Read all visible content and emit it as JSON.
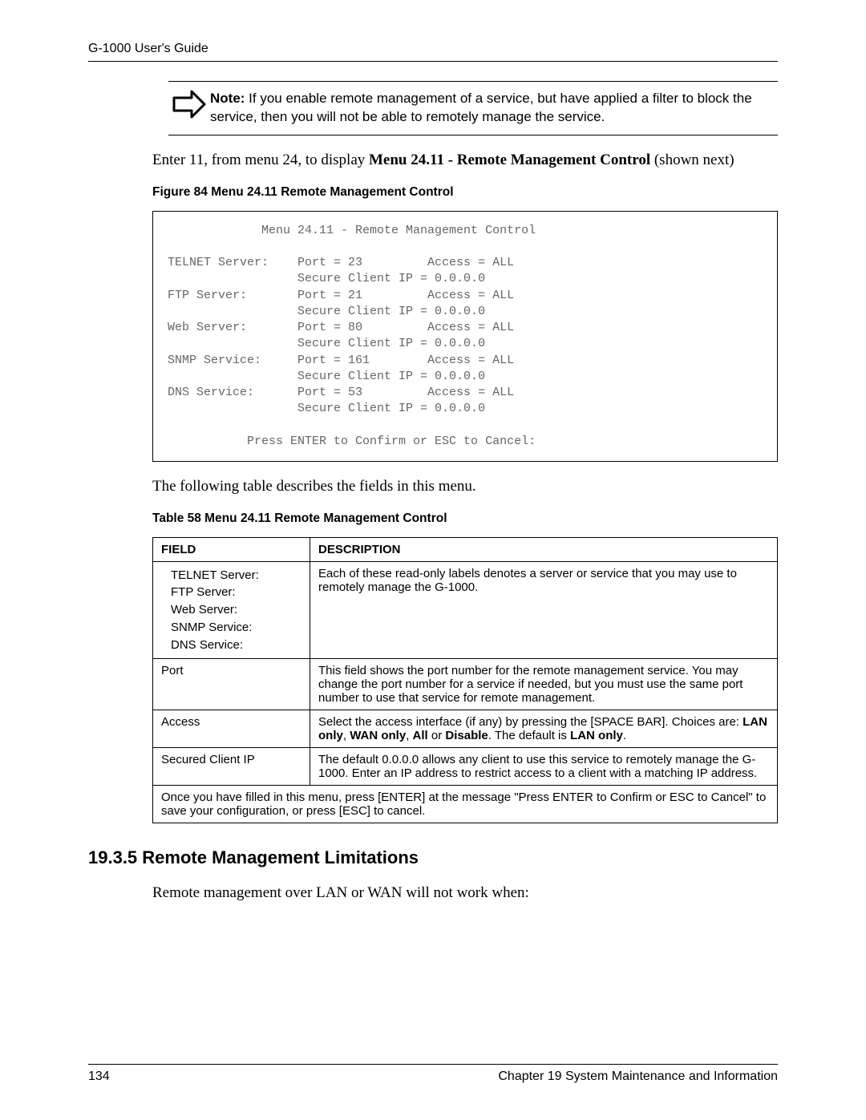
{
  "header": {
    "running_head": "G-1000 User's Guide"
  },
  "note": {
    "prefix": "Note:",
    "text": " If you enable remote management of a service, but have applied a filter to block the service, then you will not be able to remotely manage the service."
  },
  "intro_para_pre": "Enter 11, from menu 24, to display ",
  "intro_para_bold": "Menu 24.11 - Remote Management Control",
  "intro_para_post": " (shown next)",
  "figure_caption": "Figure 84   Menu 24.11 Remote Management Control",
  "code_block": "             Menu 24.11 - Remote Management Control\n\nTELNET Server:    Port = 23         Access = ALL\n                  Secure Client IP = 0.0.0.0\nFTP Server:       Port = 21         Access = ALL\n                  Secure Client IP = 0.0.0.0\nWeb Server:       Port = 80         Access = ALL\n                  Secure Client IP = 0.0.0.0\nSNMP Service:     Port = 161        Access = ALL\n                  Secure Client IP = 0.0.0.0\nDNS Service:      Port = 53         Access = ALL\n                  Secure Client IP = 0.0.0.0\n\n           Press ENTER to Confirm or ESC to Cancel:",
  "table_intro": "The following table describes the fields in this menu.",
  "table_caption": "Table 58   Menu 24.11 Remote Management Control",
  "table": {
    "head": {
      "field": "FIELD",
      "description": "DESCRIPTION"
    },
    "rows": [
      {
        "field_lines": [
          "TELNET Server:",
          "FTP Server:",
          "Web Server:",
          "SNMP Service:",
          "DNS Service:"
        ],
        "description": "Each of these read-only labels denotes a server or service that you may use to remotely manage the G-1000."
      },
      {
        "field": "Port",
        "description": "This field shows the port number for the remote management service. You may change the port number for a service if needed, but you must use the same port number to use that service for remote management."
      },
      {
        "field": "Access",
        "desc_pre": "Select the access interface (if any) by pressing the [SPACE BAR]. Choices are: ",
        "desc_bold1": "LAN only",
        "desc_mid1": ", ",
        "desc_bold2": "WAN only",
        "desc_mid2": ", ",
        "desc_bold3": "All",
        "desc_mid3": " or ",
        "desc_bold4": "Disable",
        "desc_mid4": ". The default is ",
        "desc_bold5": "LAN only",
        "desc_post": "."
      },
      {
        "field": "Secured Client IP",
        "description": "The default 0.0.0.0 allows any client to use this service to remotely manage the G-1000. Enter an IP address to restrict access to a client with a matching IP address."
      }
    ],
    "footer_row": "Once you have filled in this menu, press [ENTER] at the message \"Press ENTER to Confirm or ESC to Cancel\" to save your configuration, or press [ESC] to cancel."
  },
  "section": {
    "heading": "19.3.5  Remote Management Limitations",
    "para": "Remote management over LAN or WAN will not work when:"
  },
  "footer": {
    "page_number": "134",
    "chapter": "Chapter 19 System Maintenance and Information"
  }
}
